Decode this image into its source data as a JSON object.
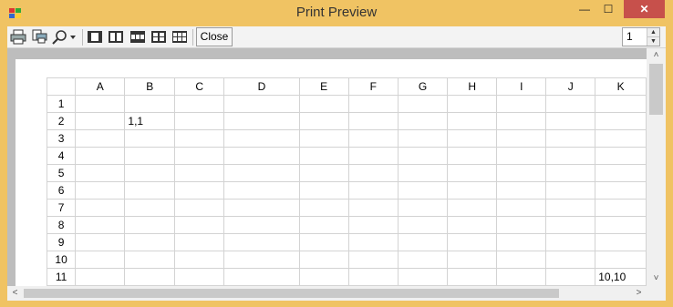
{
  "window": {
    "title": "Print Preview",
    "controls": {
      "minimize": "—",
      "maximize": "☐",
      "close": "✕"
    }
  },
  "toolbar": {
    "icons": [
      "printer-icon",
      "print-setup-icon",
      "zoom-icon",
      "zoom-dropdown-icon",
      "one-page-icon",
      "two-pages-icon",
      "three-pages-icon",
      "four-pages-icon",
      "six-pages-icon"
    ],
    "close_label": "Close",
    "page_value": "1",
    "spin_up": "▲",
    "spin_down": "▼"
  },
  "sheet": {
    "columns": [
      "",
      "A",
      "B",
      "C",
      "D",
      "E",
      "F",
      "G",
      "H",
      "I",
      "J",
      "K"
    ],
    "rows": [
      [
        "1",
        "",
        "",
        "",
        "",
        "",
        "",
        "",
        "",
        "",
        "",
        ""
      ],
      [
        "2",
        "",
        "1,1",
        "",
        "",
        "",
        "",
        "",
        "",
        "",
        "",
        ""
      ],
      [
        "3",
        "",
        "",
        "",
        "",
        "",
        "",
        "",
        "",
        "",
        "",
        ""
      ],
      [
        "4",
        "",
        "",
        "",
        "",
        "",
        "",
        "",
        "",
        "",
        "",
        ""
      ],
      [
        "5",
        "",
        "",
        "",
        "",
        "",
        "",
        "",
        "",
        "",
        "",
        ""
      ],
      [
        "6",
        "",
        "",
        "",
        "",
        "",
        "",
        "",
        "",
        "",
        "",
        ""
      ],
      [
        "7",
        "",
        "",
        "",
        "",
        "",
        "",
        "",
        "",
        "",
        "",
        ""
      ],
      [
        "8",
        "",
        "",
        "",
        "",
        "",
        "",
        "",
        "",
        "",
        "",
        ""
      ],
      [
        "9",
        "",
        "",
        "",
        "",
        "",
        "",
        "",
        "",
        "",
        "",
        ""
      ],
      [
        "10",
        "",
        "",
        "",
        "",
        "",
        "",
        "",
        "",
        "",
        "",
        ""
      ],
      [
        "11",
        "",
        "",
        "",
        "",
        "",
        "",
        "",
        "",
        "",
        "",
        "10,10"
      ]
    ]
  },
  "scrollbars": {
    "up": "˄",
    "down": "˅",
    "left": "<",
    "right": ">"
  },
  "colors": {
    "window_frame": "#f0c363",
    "close_button": "#c7504b",
    "preview_background": "#a9a9a9"
  }
}
